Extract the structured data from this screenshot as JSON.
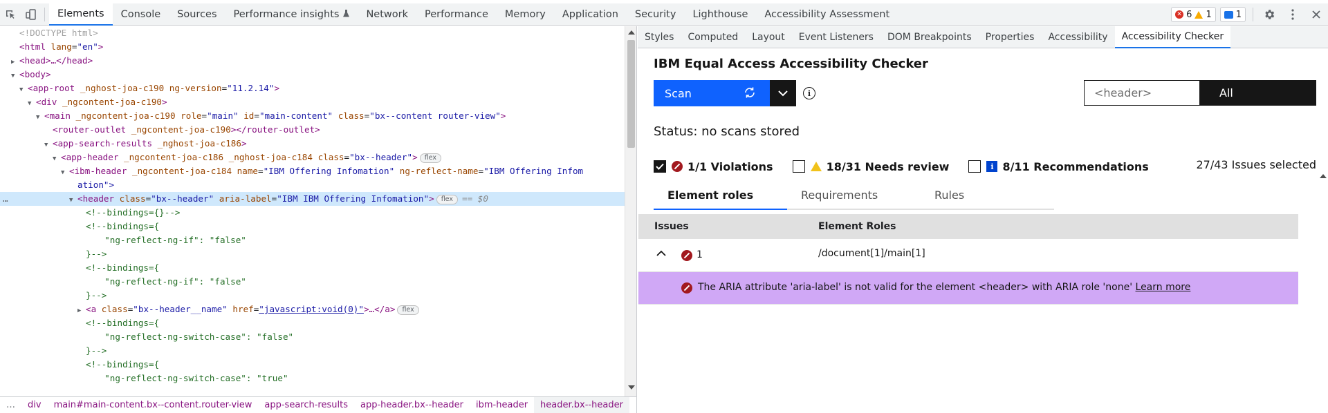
{
  "toolbar": {
    "tabs": [
      {
        "label": "Elements",
        "active": true
      },
      {
        "label": "Console"
      },
      {
        "label": "Sources"
      },
      {
        "label": "Performance insights",
        "beaker": "flask-icon"
      },
      {
        "label": "Network"
      },
      {
        "label": "Performance"
      },
      {
        "label": "Memory"
      },
      {
        "label": "Application"
      },
      {
        "label": "Security"
      },
      {
        "label": "Lighthouse"
      },
      {
        "label": "Accessibility Assessment"
      }
    ],
    "errors_count": "6",
    "warnings_count": "1",
    "messages_count": "1"
  },
  "dom": {
    "lines": [
      {
        "doctype": "<!DOCTYPE html>"
      },
      {
        "open": "<html",
        "attrs": [
          [
            "lang",
            "\"en\""
          ]
        ],
        "close": ">"
      },
      {
        "collapsed": "<head>…</head>"
      },
      {
        "open": "<body>"
      },
      {
        "open": "<app-root",
        "attrs": [
          [
            "_nghost-joa-c190",
            ""
          ],
          [
            "ng-version",
            "\"11.2.14\""
          ]
        ],
        "close": ">"
      },
      {
        "open": "<div",
        "attrs": [
          [
            "_ngcontent-joa-c190",
            ""
          ]
        ],
        "close": ">"
      },
      {
        "open": "<main",
        "attrs": [
          [
            "_ngcontent-joa-c190",
            ""
          ],
          [
            "role",
            "\"main\""
          ],
          [
            "id",
            "\"main-content\""
          ],
          [
            "class",
            "\"bx--content router-view\""
          ]
        ],
        "close": ">"
      },
      {
        "open": "<router-outlet",
        "attrs": [
          [
            "_ngcontent-joa-c190",
            ""
          ]
        ],
        "close": "></router-outlet>"
      },
      {
        "open": "<app-search-results",
        "attrs": [
          [
            "_nghost-joa-c186",
            ""
          ]
        ],
        "close": ">"
      },
      {
        "open": "<app-header",
        "attrs": [
          [
            "_ngcontent-joa-c186",
            ""
          ],
          [
            "_nghost-joa-c184",
            ""
          ],
          [
            "class",
            "\"bx--header\""
          ]
        ],
        "close": ">",
        "badge": "flex"
      },
      {
        "open": "<ibm-header",
        "attrs": [
          [
            "_ngcontent-joa-c184",
            ""
          ],
          [
            "name",
            "\"IBM Offering Infomation\""
          ],
          [
            "ng-reflect-name",
            "\"IBM Offering Infom"
          ]
        ],
        "close": ""
      },
      {
        "cont": "ation\">"
      },
      {
        "open": "<header",
        "attrs": [
          [
            "class",
            "\"bx--header\""
          ],
          [
            "aria-label",
            "\"IBM IBM Offering Infomation\""
          ]
        ],
        "close": ">",
        "badge": "flex",
        "eq": "== $0"
      },
      {
        "comment": "<!--bindings={}-->"
      },
      {
        "comment": "<!--bindings={"
      },
      {
        "comment": "  \"ng-reflect-ng-if\": \"false\""
      },
      {
        "comment": "}-->"
      },
      {
        "comment": "<!--bindings={"
      },
      {
        "comment": "  \"ng-reflect-ng-if\": \"false\""
      },
      {
        "comment": "}-->"
      },
      {
        "open": "<a",
        "attrs": [
          [
            "class",
            "\"bx--header__name\""
          ],
          [
            "href",
            "\"javascript:void(0)\""
          ]
        ],
        "close": ">…</a>",
        "badge": "flex"
      },
      {
        "comment": "<!--bindings={"
      },
      {
        "comment": "  \"ng-reflect-ng-switch-case\": \"false\""
      },
      {
        "comment": "}-->"
      },
      {
        "comment": "<!--bindings={"
      },
      {
        "comment": "  \"ng-reflect-ng-switch-case\": \"true\""
      }
    ]
  },
  "breadcrumb": [
    "…",
    "div",
    "main#main-content.bx--content.router-view",
    "app-search-results",
    "app-header.bx--header",
    "ibm-header",
    "header.bx--header",
    "…"
  ],
  "subtabs": [
    "Styles",
    "Computed",
    "Layout",
    "Event Listeners",
    "DOM Breakpoints",
    "Properties",
    "Accessibility",
    "Accessibility Checker"
  ],
  "checker": {
    "title": "IBM Equal Access Accessibility Checker",
    "scan_label": "Scan",
    "focus_value": "<header>",
    "focus_all": "All",
    "status": "Status: no scans stored",
    "filters": {
      "violations": "1/1 Violations",
      "needs_review": "18/31 Needs review",
      "recommendations": "8/11 Recommendations"
    },
    "issues_selected": "27/43 Issues selected",
    "view_tabs": [
      "Element roles",
      "Requirements",
      "Rules"
    ],
    "table": {
      "col_issues": "Issues",
      "col_roles": "Element Roles",
      "row_count": "1",
      "row_role": "/document[1]/main[1]",
      "message": "The ARIA attribute 'aria-label' is not valid for the element <header> with ARIA role 'none'",
      "learn_more": "Learn more"
    }
  },
  "colors": {
    "accent": "#1a73e8",
    "scan_blue": "#0f62fe",
    "violation": "#a2191f",
    "highlight_row": "#d0a8f6"
  }
}
